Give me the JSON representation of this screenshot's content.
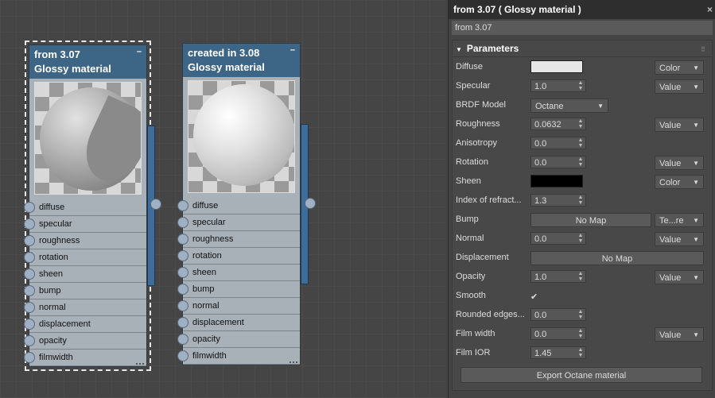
{
  "nodes": [
    {
      "title_line1": "from 3.07",
      "title_line2": "Glossy material",
      "minimize": "–",
      "ports": [
        "diffuse",
        "specular",
        "roughness",
        "rotation",
        "sheen",
        "bump",
        "normal",
        "displacement",
        "opacity",
        "filmwidth"
      ]
    },
    {
      "title_line1": "created in 3.08",
      "title_line2": "Glossy material",
      "minimize": "–",
      "ports": [
        "diffuse",
        "specular",
        "roughness",
        "rotation",
        "sheen",
        "bump",
        "normal",
        "displacement",
        "opacity",
        "filmwidth"
      ]
    }
  ],
  "panel": {
    "title": "from 3.07  ( Glossy material )",
    "close": "×",
    "name_value": "from 3.07",
    "section_title": "Parameters",
    "params": [
      {
        "label": "Diffuse",
        "kind": "color",
        "color": "#e6e6e6",
        "dropdown": "Color"
      },
      {
        "label": "Specular",
        "kind": "spinner",
        "value": "1.0",
        "dropdown": "Value"
      },
      {
        "label": "BRDF Model",
        "kind": "select",
        "value": "Octane"
      },
      {
        "label": "Roughness",
        "kind": "spinner",
        "value": "0.0632",
        "dropdown": "Value"
      },
      {
        "label": "Anisotropy",
        "kind": "spinner",
        "value": "0.0"
      },
      {
        "label": "Rotation",
        "kind": "spinner",
        "value": "0.0",
        "dropdown": "Value"
      },
      {
        "label": "Sheen",
        "kind": "color",
        "color": "#000000",
        "dropdown": "Color"
      },
      {
        "label": "Index of refract...",
        "kind": "spinner",
        "value": "1.3"
      },
      {
        "label": "Bump",
        "kind": "map",
        "value": "No Map",
        "dropdown": "Te...re"
      },
      {
        "label": "Normal",
        "kind": "spinner",
        "value": "0.0",
        "dropdown": "Value"
      },
      {
        "label": "Displacement",
        "kind": "wide-map",
        "value": "No Map"
      },
      {
        "label": "Opacity",
        "kind": "spinner",
        "value": "1.0",
        "dropdown": "Value"
      },
      {
        "label": "Smooth",
        "kind": "check",
        "value": "✔"
      },
      {
        "label": "Rounded edges...",
        "kind": "spinner",
        "value": "0.0"
      },
      {
        "label": "Film width",
        "kind": "spinner",
        "value": "0.0",
        "dropdown": "Value"
      },
      {
        "label": "Film IOR",
        "kind": "spinner",
        "value": "1.45"
      }
    ],
    "export_button": "Export Octane material"
  }
}
